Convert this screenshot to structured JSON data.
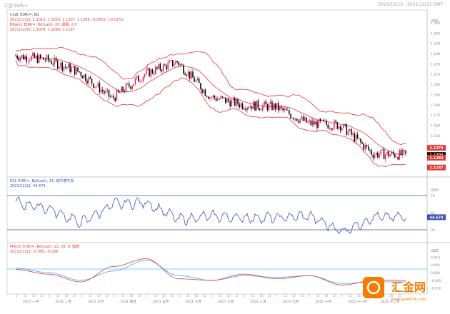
{
  "window": {
    "title": "汇金 EUR/=",
    "date_range": "2021/12/13 - 2021/12/13 GMT"
  },
  "price_panel": {
    "header_line1": "Cndl, EUR/=, Bd",
    "header_line2": "2021/12/13, 1.1315, 1.1316, 1.1307, 1.1309, -0.0002, (-0.02%)",
    "header_line3": "BBand, EUR/=, Bd(Last), 20, 调整, 2.0",
    "header_line4": "2021/12/13, 1.1379, 1.1283, 1.1187",
    "axis_label": "USD",
    "y_ticks": [
      "1.260",
      "1.250",
      "1.240",
      "1.230",
      "1.220",
      "1.210",
      "1.200",
      "1.190",
      "1.180",
      "1.170",
      "1.160",
      "1.150",
      "1.140",
      "1.130",
      "1.120"
    ],
    "price_badges": [
      {
        "value": "1.1379",
        "color": "#e53935"
      },
      {
        "value": "1.1309",
        "color": "#000000"
      },
      {
        "value": "1.1283",
        "color": "#e53935"
      },
      {
        "value": "1.1187",
        "color": "#e53935"
      }
    ]
  },
  "rsi_panel": {
    "header_line1": "RSI, EUR/=, Bd(Last), 14, 威尔德平滑",
    "header_line2": "2021/12/13, 44.674",
    "axis_label": "USD",
    "y_ticks": [
      "70",
      "50",
      "30"
    ],
    "badge": "44.674"
  },
  "macd_panel": {
    "header_line1": "MACD, EUR/=, Bd(Last), 12, 26, 9, 指数",
    "header_line2": "2021/12/13, -0.005, -0.006",
    "axis_label": "USD",
    "y_ticks": [
      "0.010",
      "0.005",
      "0.000",
      "-0.005",
      "-0.010"
    ]
  },
  "x_axis": {
    "months": [
      "2021 一月",
      "2021 二月",
      "2021 三月",
      "2021 四月",
      "2021 五月",
      "2021 六月",
      "2021 七月",
      "2021 八月",
      "2021 九月",
      "2021 十月",
      "2021 十一月",
      "2021 十二月"
    ]
  },
  "watermark": {
    "brand": "汇金网",
    "url": "www.gold678.com"
  },
  "colors": {
    "bull": "#e91e63",
    "bear": "#000000",
    "bband": "#e53935",
    "rsi": "#3f51b5",
    "macd": "#e53935",
    "signal": "#42a5f5"
  },
  "chart_data": {
    "type": "candlestick",
    "x": [
      "2021-01",
      "2021-02",
      "2021-03",
      "2021-04",
      "2021-05",
      "2021-06",
      "2021-07",
      "2021-08",
      "2021-09",
      "2021-10",
      "2021-11",
      "2021-12"
    ],
    "price_close": [
      1.224,
      1.212,
      1.186,
      1.21,
      1.222,
      1.188,
      1.18,
      1.178,
      1.162,
      1.16,
      1.132,
      1.131
    ],
    "rsi": [
      62,
      55,
      38,
      60,
      62,
      42,
      46,
      44,
      44,
      46,
      28,
      44.674
    ],
    "macd": [
      0.002,
      -0.001,
      -0.006,
      0.004,
      0.009,
      -0.004,
      -0.005,
      -0.001,
      -0.004,
      -0.002,
      -0.008,
      -0.005
    ],
    "signal": [
      0.003,
      0.0,
      -0.005,
      0.001,
      0.008,
      -0.002,
      -0.005,
      -0.002,
      -0.003,
      -0.002,
      -0.007,
      -0.006
    ]
  }
}
